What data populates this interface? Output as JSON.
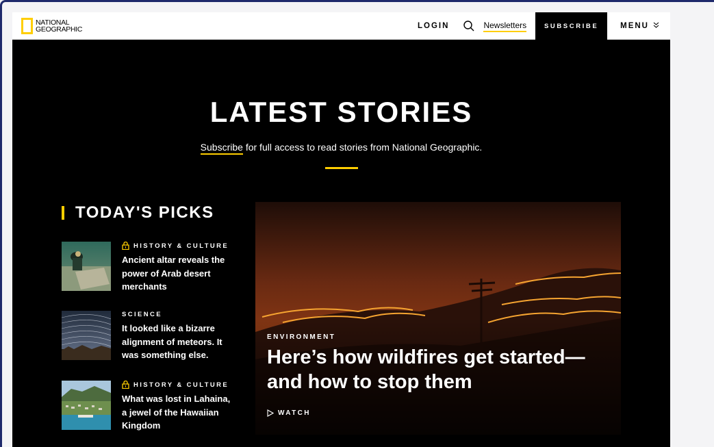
{
  "header": {
    "logo_line1": "NATIONAL",
    "logo_line2": "GEOGRAPHIC",
    "login_label": "LOGIN",
    "newsletters_label": "Newsletters",
    "subscribe_label": "SUBSCRIBE",
    "menu_label": "MENU",
    "menu_chevron": "≫"
  },
  "hero": {
    "title": "LATEST STORIES",
    "subtitle_link": "Subscribe",
    "subtitle_rest": " for full access to read stories from National Geographic."
  },
  "picks": {
    "title": "TODAY'S PICKS",
    "items": [
      {
        "category": "HISTORY & CULTURE",
        "locked": true,
        "headline": "Ancient altar reveals the power of Arab desert merchants"
      },
      {
        "category": "SCIENCE",
        "locked": false,
        "headline": "It looked like a bizarre alignment of meteors. It was something else."
      },
      {
        "category": "HISTORY & CULTURE",
        "locked": true,
        "headline": "What was lost in Lahaina, a jewel of the Hawaiian Kingdom"
      }
    ]
  },
  "feature": {
    "category": "ENVIRONMENT",
    "headline": "Here’s how wildfires get started—and how to stop them",
    "watch_label": "WATCH"
  },
  "colors": {
    "accent": "#ffce00",
    "background": "#000000",
    "text": "#ffffff"
  },
  "icons": [
    "search-icon",
    "lock-icon",
    "play-icon",
    "chevron-down-icon"
  ]
}
